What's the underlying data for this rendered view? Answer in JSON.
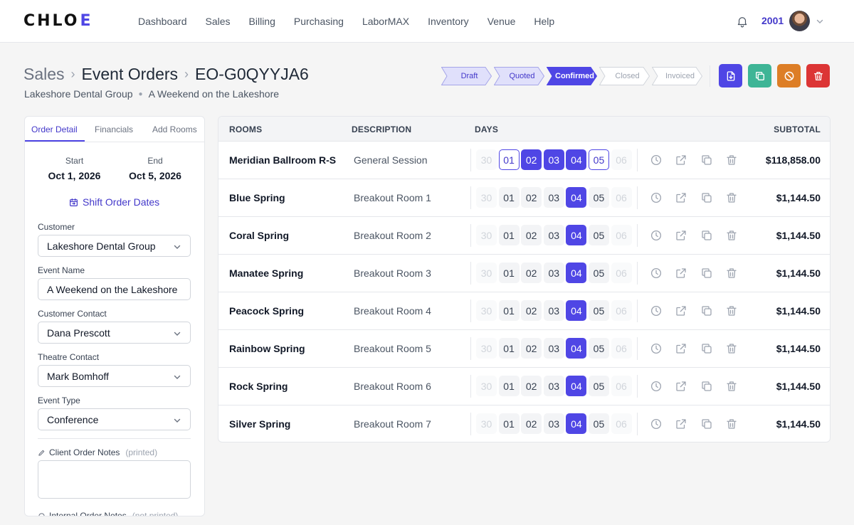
{
  "brand": {
    "name_left": "CHLO",
    "name_accent": "E",
    "accent_color": "#4f46e5"
  },
  "nav": [
    "Dashboard",
    "Sales",
    "Billing",
    "Purchasing",
    "LaborMAX",
    "Inventory",
    "Venue",
    "Help"
  ],
  "user": {
    "id": "2001"
  },
  "breadcrumb": {
    "root": "Sales",
    "section": "Event Orders",
    "current": "EO-G0QYYJA6"
  },
  "subtitle": {
    "customer": "Lakeshore Dental Group",
    "event": "A Weekend on the Lakeshore"
  },
  "status_steps": [
    {
      "label": "Draft",
      "state": "past"
    },
    {
      "label": "Quoted",
      "state": "past"
    },
    {
      "label": "Confirmed",
      "state": "current"
    },
    {
      "label": "Closed",
      "state": "future"
    },
    {
      "label": "Invoiced",
      "state": "future"
    }
  ],
  "actions": [
    {
      "name": "export",
      "color": "#4f46e5",
      "icon": "file-download-icon"
    },
    {
      "name": "copy",
      "color": "#3eb596",
      "icon": "copy-icon"
    },
    {
      "name": "cancel",
      "color": "#dd7e26",
      "icon": "ban-icon"
    },
    {
      "name": "delete",
      "color": "#dc3535",
      "icon": "trash-icon"
    }
  ],
  "panel": {
    "tabs": [
      "Order Detail",
      "Financials",
      "Add Rooms"
    ],
    "start_label": "Start",
    "start_value": "Oct 1, 2026",
    "end_label": "End",
    "end_value": "Oct 5, 2026",
    "shift_label": "Shift Order Dates",
    "customer_label": "Customer",
    "customer_value": "Lakeshore Dental Group",
    "event_name_label": "Event Name",
    "event_name_value": "A Weekend on the Lakeshore",
    "customer_contact_label": "Customer Contact",
    "customer_contact_value": "Dana Prescott",
    "theatre_contact_label": "Theatre Contact",
    "theatre_contact_value": "Mark Bomhoff",
    "event_type_label": "Event Type",
    "event_type_value": "Conference",
    "client_notes_label": "Client Order Notes",
    "client_notes_hint": "(printed)",
    "internal_notes_label": "Internal Order Notes",
    "internal_notes_hint": "(not printed)"
  },
  "table": {
    "headers": {
      "rooms": "ROOMS",
      "description": "DESCRIPTION",
      "days": "DAYS",
      "subtotal": "SUBTOTAL"
    },
    "day_labels": [
      "30",
      "01",
      "02",
      "03",
      "04",
      "05",
      "06"
    ],
    "rows": [
      {
        "name": "Meridian Ballroom R-S",
        "description": "General Session",
        "days": [
          "off",
          "outline",
          "sel",
          "sel",
          "sel",
          "outline",
          "off"
        ],
        "subtotal": "$118,858.00"
      },
      {
        "name": "Blue Spring",
        "description": "Breakout Room 1",
        "days": [
          "off",
          "on",
          "on",
          "on",
          "sel",
          "on",
          "off"
        ],
        "subtotal": "$1,144.50"
      },
      {
        "name": "Coral Spring",
        "description": "Breakout Room 2",
        "days": [
          "off",
          "on",
          "on",
          "on",
          "sel",
          "on",
          "off"
        ],
        "subtotal": "$1,144.50"
      },
      {
        "name": "Manatee Spring",
        "description": "Breakout Room 3",
        "days": [
          "off",
          "on",
          "on",
          "on",
          "sel",
          "on",
          "off"
        ],
        "subtotal": "$1,144.50"
      },
      {
        "name": "Peacock Spring",
        "description": "Breakout Room 4",
        "days": [
          "off",
          "on",
          "on",
          "on",
          "sel",
          "on",
          "off"
        ],
        "subtotal": "$1,144.50"
      },
      {
        "name": "Rainbow Spring",
        "description": "Breakout Room 5",
        "days": [
          "off",
          "on",
          "on",
          "on",
          "sel",
          "on",
          "off"
        ],
        "subtotal": "$1,144.50"
      },
      {
        "name": "Rock Spring",
        "description": "Breakout Room 6",
        "days": [
          "off",
          "on",
          "on",
          "on",
          "sel",
          "on",
          "off"
        ],
        "subtotal": "$1,144.50"
      },
      {
        "name": "Silver Spring",
        "description": "Breakout Room 7",
        "days": [
          "off",
          "on",
          "on",
          "on",
          "sel",
          "on",
          "off"
        ],
        "subtotal": "$1,144.50"
      }
    ]
  }
}
